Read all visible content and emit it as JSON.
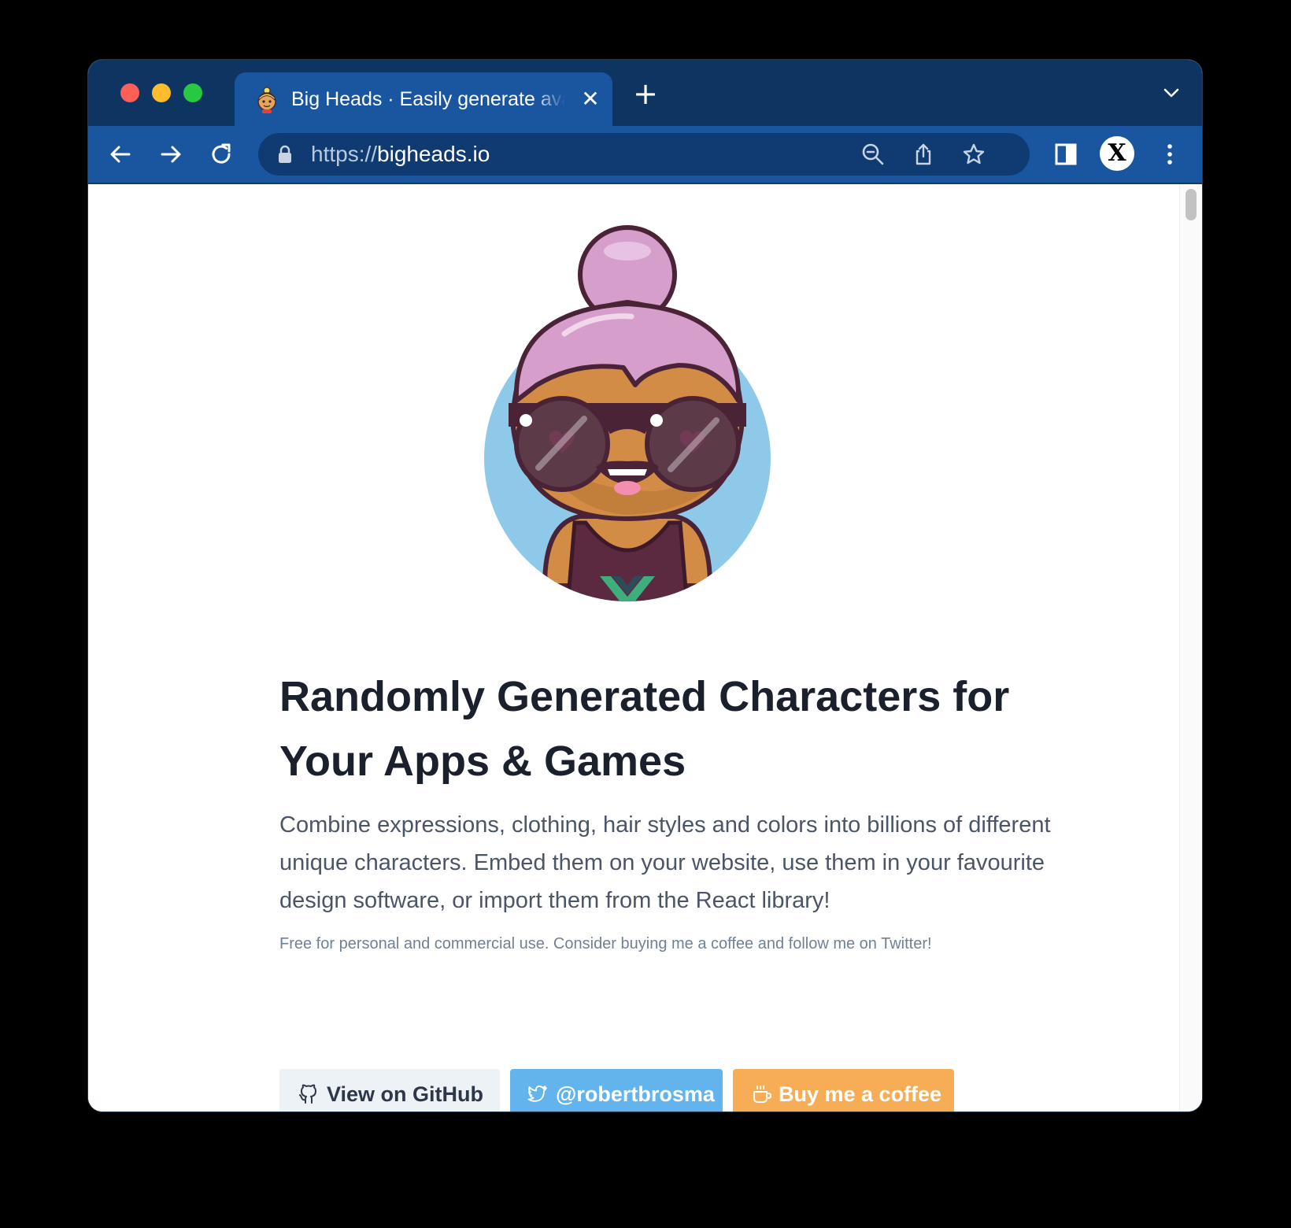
{
  "browser": {
    "tab": {
      "title": "Big Heads · Easily generate avatars",
      "favicon": "big-heads-favicon"
    },
    "url": {
      "scheme": "https://",
      "host": "bigheads.io"
    },
    "profile_initial": "X"
  },
  "page": {
    "headline": "Randomly Generated Characters for Your Apps & Games",
    "lead": "Combine expressions, clothing, hair styles and colors into billions of different unique characters. Embed them on your website, use them in your favourite design software, or import them from the React library!",
    "fine_print": "Free for personal and commercial use. Consider buying me a coffee and follow me on Twitter!",
    "buttons": {
      "github": {
        "label": "View on GitHub",
        "icon": "github-icon"
      },
      "twitter": {
        "label": "@robertbrosma",
        "icon": "twitter-icon"
      },
      "coffee": {
        "label": "Buy me a coffee",
        "icon": "coffee-icon"
      }
    }
  },
  "colors": {
    "titlebar": "#0e3461",
    "toolbar": "#1a56a0",
    "twitter_button": "#63b3ed",
    "coffee_button": "#f6ad55",
    "github_button": "#edf2f7"
  }
}
